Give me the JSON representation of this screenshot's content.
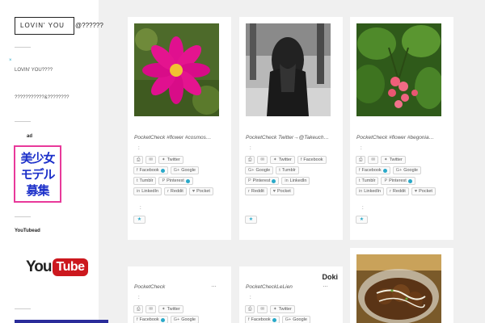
{
  "sidebar": {
    "logo_main": "LOVIN' YOU",
    "logo_rest": "@??????",
    "link1": "LOVIN' YOU????",
    "link2": "???????????&????????",
    "ad_heading": "ad",
    "ad_banner": [
      "美少女",
      "モデル",
      "募集"
    ],
    "youtube_heading": "YouTubead",
    "yt_you": "You",
    "yt_tube": "Tube"
  },
  "cards": [
    {
      "caption": "PocketCheck #flower #cosmos…",
      "colon": ":",
      "buttons": [
        [
          "⎙",
          ""
        ],
        [
          "✉",
          ""
        ],
        [
          "🐦",
          "Twitter"
        ],
        [
          "f",
          "Facebook"
        ],
        [
          "G+",
          "Google"
        ],
        [
          "t",
          "Tumblr"
        ],
        [
          "P",
          "Pinterest"
        ],
        [
          "in",
          "LinkedIn"
        ],
        [
          "r",
          "Reddit"
        ],
        [
          "♥",
          "Pocket"
        ]
      ],
      "extra_colon": ":",
      "fav": "★"
    },
    {
      "caption": "PocketCheck Twitter→@Takeuch…",
      "colon": ":",
      "buttons": [
        [
          "⎙",
          ""
        ],
        [
          "✉",
          ""
        ],
        [
          "🐦",
          "Twitter"
        ],
        [
          "f",
          "Facebook"
        ],
        [
          "G+",
          "Google"
        ],
        [
          "t",
          "Tumblr"
        ],
        [
          "P",
          "Pinterest"
        ],
        [
          "in",
          "LinkedIn"
        ],
        [
          "r",
          "Reddit"
        ],
        [
          "♥",
          "Pocket"
        ]
      ],
      "fav": "★"
    },
    {
      "caption": "PocketCheck #flower #begonia…",
      "colon": ":",
      "buttons": [
        [
          "⎙",
          ""
        ],
        [
          "✉",
          ""
        ],
        [
          "🐦",
          "Twitter"
        ],
        [
          "f",
          "Facebook"
        ],
        [
          "G+",
          "Google"
        ],
        [
          "t",
          "Tumblr"
        ],
        [
          "P",
          "Pinterest"
        ],
        [
          "in",
          "LinkedIn"
        ],
        [
          "r",
          "Reddit"
        ],
        [
          "♥",
          "Pocket"
        ]
      ],
      "extra_colon": ":",
      "fav": "★"
    },
    {
      "caption": "PocketCheck",
      "dots": "…",
      "colon": ":",
      "buttons": [
        [
          "⎙",
          ""
        ],
        [
          "✉",
          ""
        ],
        [
          "🐦",
          "Twitter"
        ],
        [
          "f",
          "Facebook"
        ],
        [
          "G+",
          "Google"
        ]
      ]
    },
    {
      "caption": "PocketCheckLeLien",
      "dots": "…",
      "colon": ":",
      "doki": "Doki",
      "buttons": [
        [
          "⎙",
          ""
        ],
        [
          "✉",
          ""
        ],
        [
          "🐦",
          "Twitter"
        ],
        [
          "f",
          "Facebook"
        ],
        [
          "G+",
          "Google"
        ]
      ]
    }
  ]
}
